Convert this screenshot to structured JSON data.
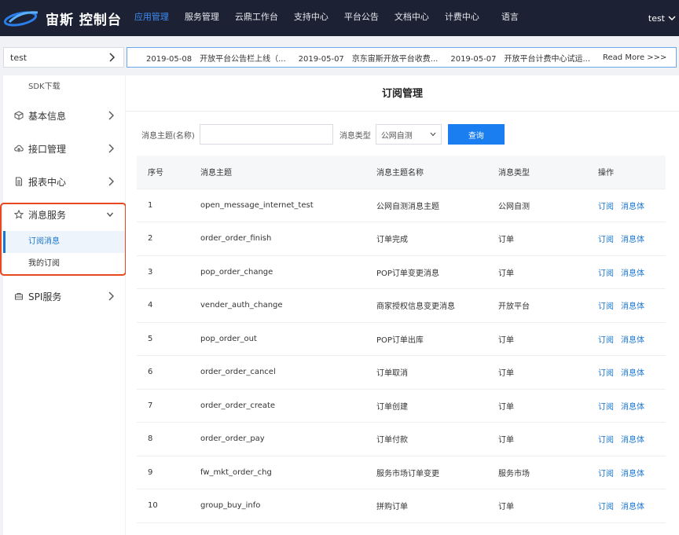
{
  "brand": {
    "name": "宙斯 控制台"
  },
  "nav": {
    "items": [
      "应用管理",
      "服务管理",
      "云鼎工作台",
      "支持中心",
      "平台公告",
      "文档中心",
      "计费中心"
    ],
    "lang": "语言",
    "user": "test"
  },
  "app_selector": {
    "value": "test"
  },
  "notices": [
    {
      "date": "2019-05-08",
      "text": "开放平台公告栏上线（..."
    },
    {
      "date": "2019-05-07",
      "text": "京东宙斯开放平台收费..."
    },
    {
      "date": "2019-05-07",
      "text": "开放平台计费中心试运..."
    }
  ],
  "notice_more": "Read More >>>",
  "sidebar": {
    "sdk": "SDK下载",
    "groups": [
      {
        "label": "基本信息",
        "icon": "cube-icon"
      },
      {
        "label": "接口管理",
        "icon": "cloud-upload-icon"
      },
      {
        "label": "报表中心",
        "icon": "document-icon"
      },
      {
        "label": "消息服务",
        "icon": "star-icon"
      },
      {
        "label": "SPI服务",
        "icon": "briefcase-icon"
      }
    ],
    "msg_subitems": [
      "订阅消息",
      "我的订阅"
    ]
  },
  "main": {
    "title": "订阅管理",
    "filter": {
      "topic_label": "消息主题(名称)",
      "topic_value": "",
      "type_label": "消息类型",
      "type_value": "公网自测",
      "query_button": "查询"
    },
    "table": {
      "headers": [
        "序号",
        "消息主题",
        "消息主题名称",
        "消息类型",
        "操作"
      ],
      "op_subscribe": "订阅",
      "op_body": "消息体",
      "rows": [
        [
          "1",
          "open_message_internet_test",
          "公网自测消息主题",
          "公网自测"
        ],
        [
          "2",
          "order_order_finish",
          "订单完成",
          "订单"
        ],
        [
          "3",
          "pop_order_change",
          "POP订单变更消息",
          "订单"
        ],
        [
          "4",
          "vender_auth_change",
          "商家授权信息变更消息",
          "开放平台"
        ],
        [
          "5",
          "pop_order_out",
          "POP订单出库",
          "订单"
        ],
        [
          "6",
          "order_order_cancel",
          "订单取消",
          "订单"
        ],
        [
          "7",
          "order_order_create",
          "订单创建",
          "订单"
        ],
        [
          "8",
          "order_order_pay",
          "订单付款",
          "订单"
        ],
        [
          "9",
          "fw_mkt_order_chg",
          "服务市场订单变更",
          "服务市场"
        ],
        [
          "10",
          "group_buy_info",
          "拼购订单",
          "订单"
        ]
      ]
    }
  },
  "colors": {
    "topbar": "#1c2233",
    "accent": "#1a7df0",
    "highlight": "#e8481e"
  }
}
